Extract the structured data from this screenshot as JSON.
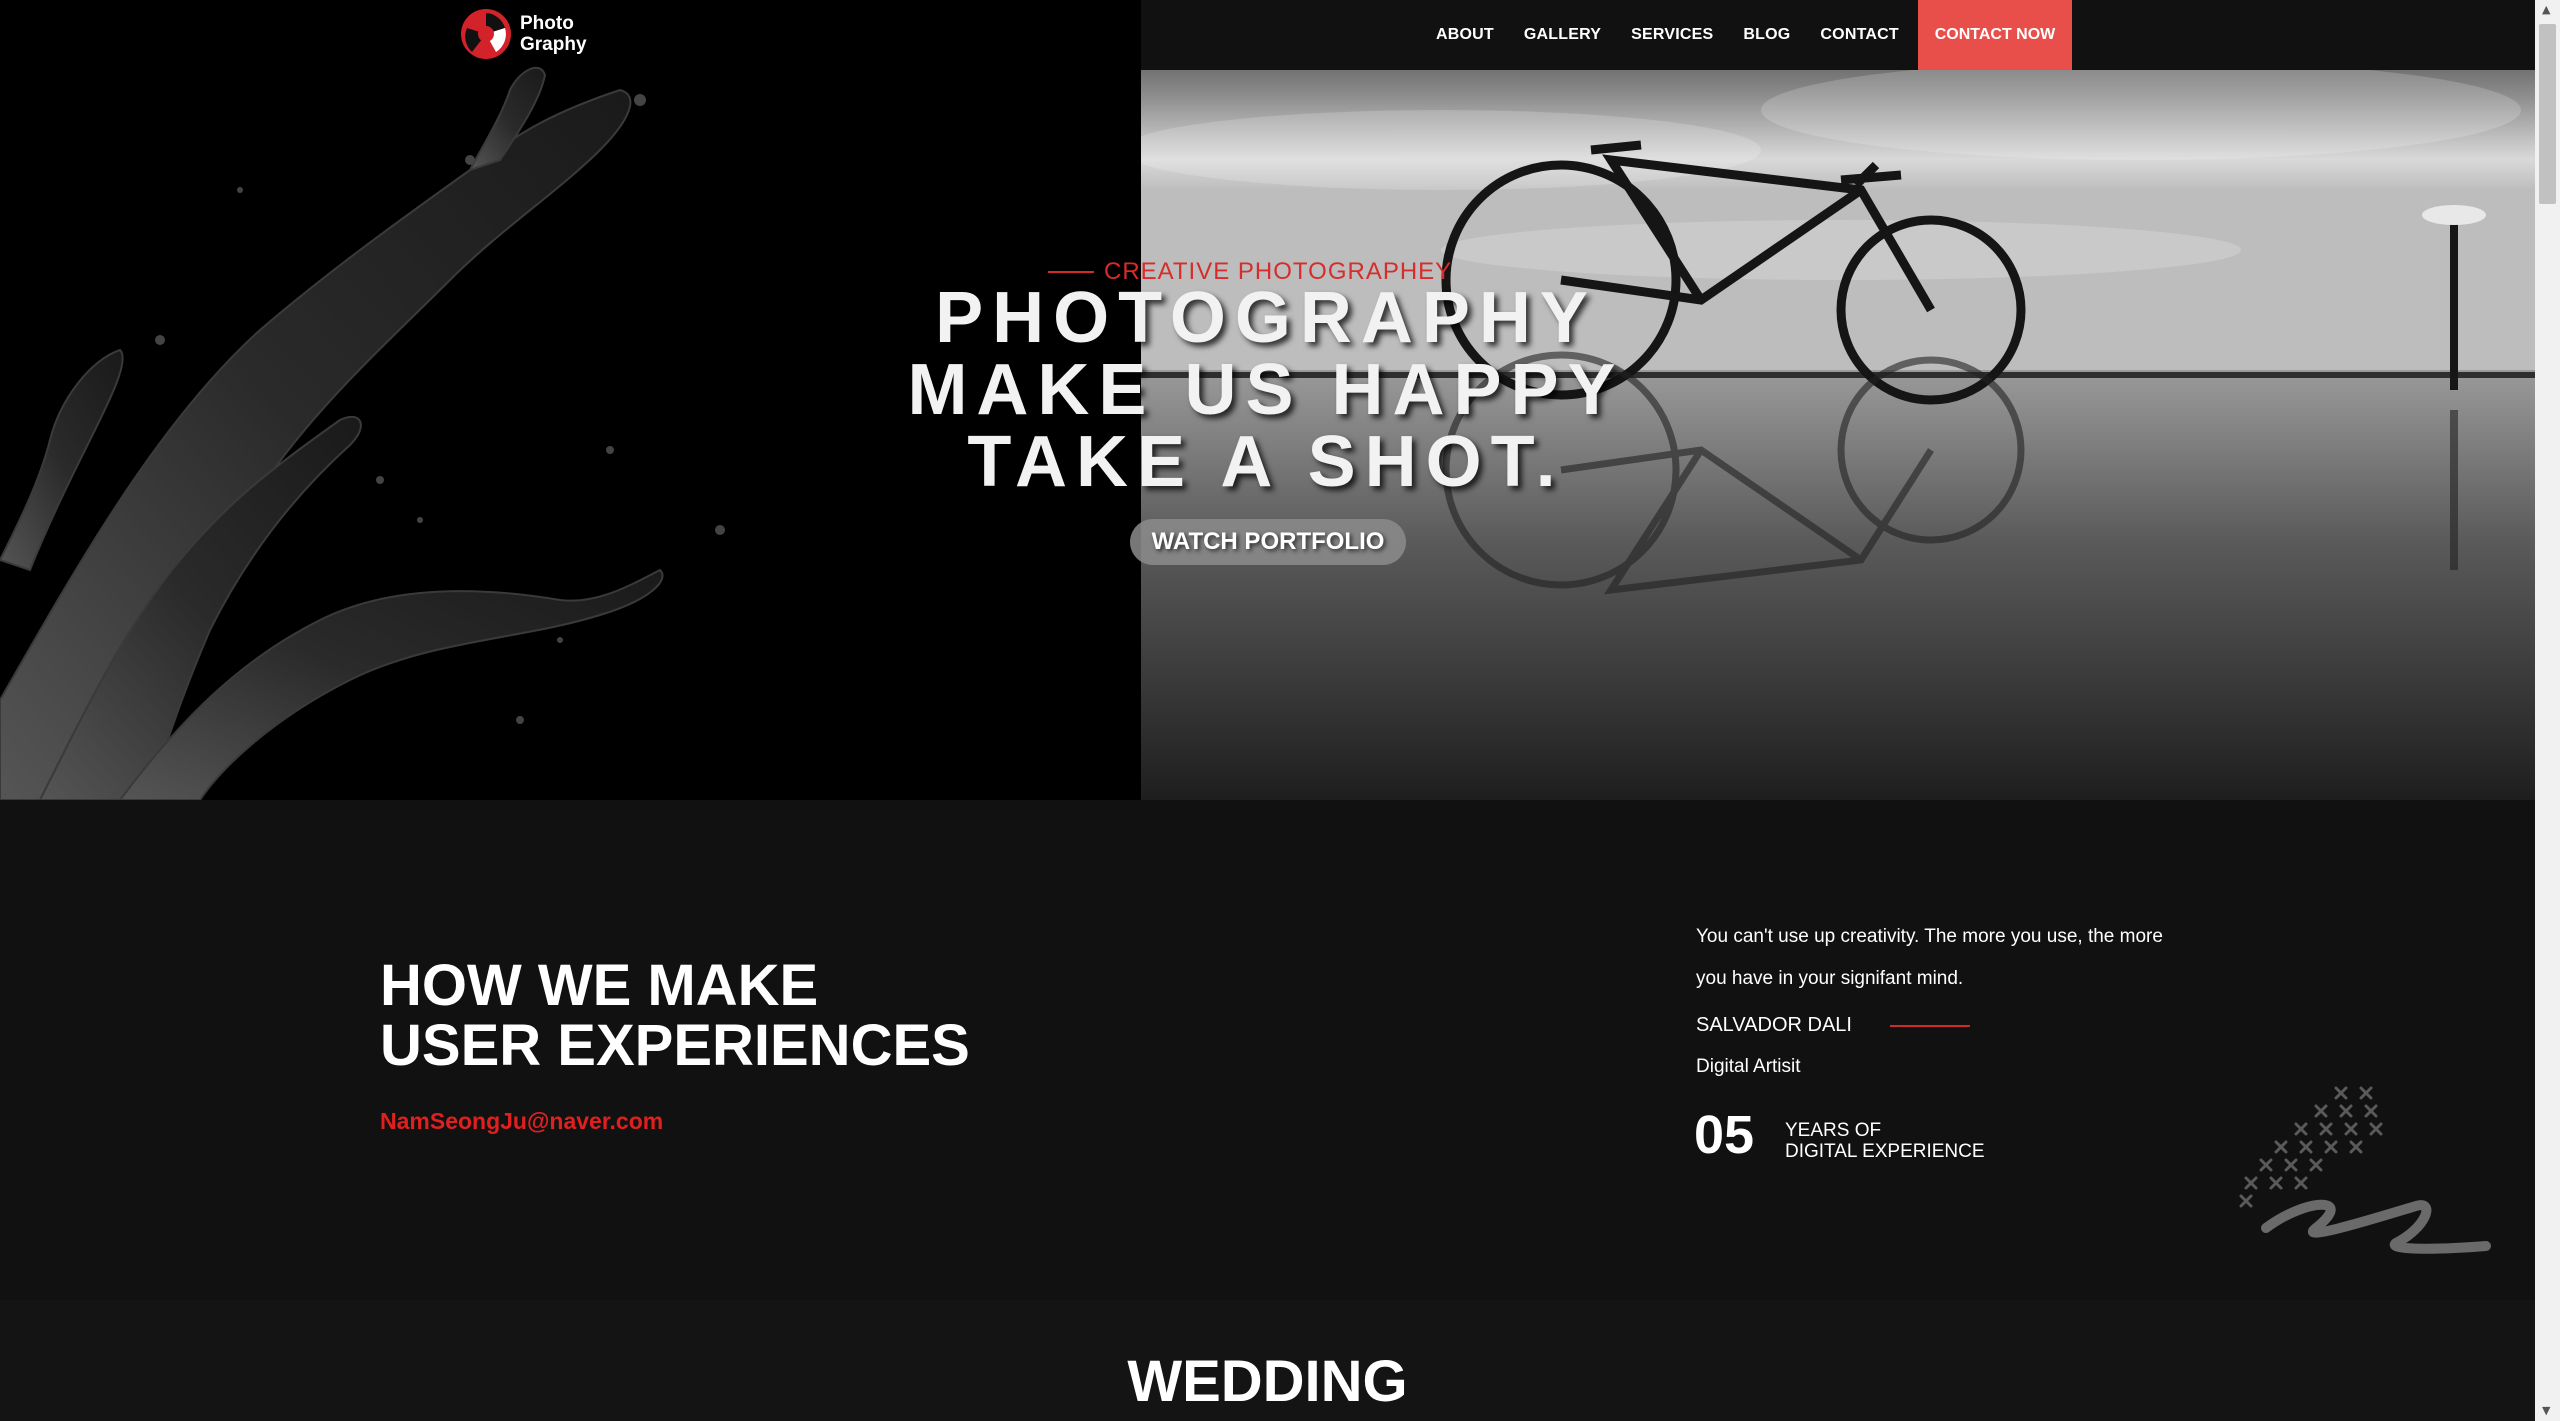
{
  "brand": {
    "logo_line1": "Photo",
    "logo_line2": "Graphy",
    "accent_color": "#e94f4a"
  },
  "nav": {
    "items": [
      {
        "label": "ABOUT"
      },
      {
        "label": "GALLERY"
      },
      {
        "label": "SERVICES"
      },
      {
        "label": "BLOG"
      },
      {
        "label": "CONTACT"
      }
    ],
    "cta": "CONTACT NOW"
  },
  "hero": {
    "eyebrow": "CREATIVE PHOTOGRAPHEY",
    "title_lines": [
      "PHOTOGRAPHY",
      "MAKE US HAPPY",
      "TAKE A SHOT."
    ],
    "button": "WATCH PORTFOLIO"
  },
  "about": {
    "title_line1": "HOW WE MAKE",
    "title_line2": "USER EXPERIENCES",
    "email": "NamSeongJu@naver.com",
    "quote": "You can't use up creativity. The more you use, the more you have in your signifant mind.",
    "author": "SALVADOR DALI",
    "role": "Digital Artisit",
    "stat_number": "05",
    "stat_label_line1": "YEARS OF",
    "stat_label_line2": "DIGITAL EXPERIENCE"
  },
  "wedding": {
    "title": "WEDDING"
  }
}
